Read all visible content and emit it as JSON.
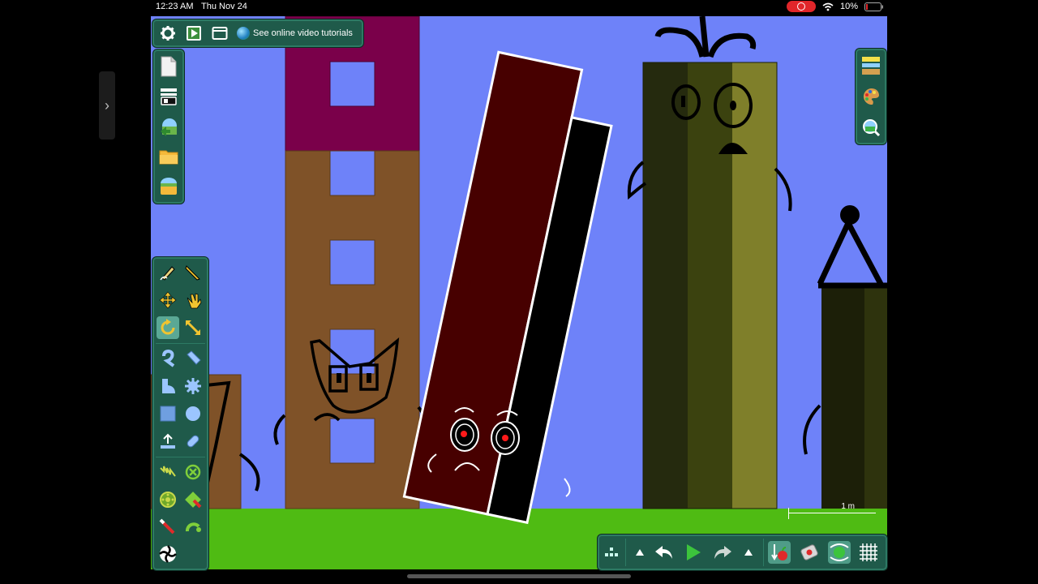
{
  "status_bar": {
    "time": "12:23 AM",
    "date": "Thu Nov 24",
    "battery": "10%"
  },
  "top_toolbar": {
    "tutorials_label": "See online video tutorials"
  },
  "scale_indicator": {
    "label": "1 m"
  },
  "icons": {
    "top": [
      "gear-icon",
      "play-scene-icon",
      "window-icon",
      "globe-icon"
    ],
    "file": [
      "new-document-icon",
      "scene-settings-icon",
      "import-image-icon",
      "open-folder-icon",
      "save-bucket-icon"
    ],
    "tools": [
      "sketch-tool-icon",
      "knife-tool-icon",
      "move-tool-icon",
      "drag-hand-icon",
      "rotate-tool-icon",
      "scale-tool-icon",
      "rope-tool-icon",
      "eraser-tool-icon",
      "polygon-tool-icon",
      "gear-shape-icon",
      "box-tool-icon",
      "circle-tool-icon",
      "plane-tool-icon",
      "chain-tool-icon",
      "spring-tool-icon",
      "fixate-tool-icon",
      "hinge-tool-icon",
      "thruster-tool-icon",
      "laser-tool-icon",
      "tracer-tool-icon",
      "texture-tool-icon"
    ],
    "right": [
      "background-layers-icon",
      "palette-icon",
      "zoom-reset-icon"
    ],
    "playback": [
      "grid-menu-icon",
      "collapse-left-icon",
      "undo-icon",
      "play-icon",
      "redo-icon",
      "collapse-right-icon",
      "gravity-icon",
      "air-friction-icon",
      "controllers-icon",
      "grid-icon"
    ]
  },
  "colors": {
    "sky": "#6e82f9",
    "ground": "#4fbb13",
    "panel": "#1f5a4a",
    "panel_border": "#2d7a64",
    "magenta_block": "#7a004a",
    "brown_block": "#7f5228",
    "dark_red_block": "#470000",
    "olive_dark": "#252a0e",
    "olive_mid": "#3b420f",
    "olive_light": "#7f7f2a",
    "record_indicator": "#e0262a"
  }
}
